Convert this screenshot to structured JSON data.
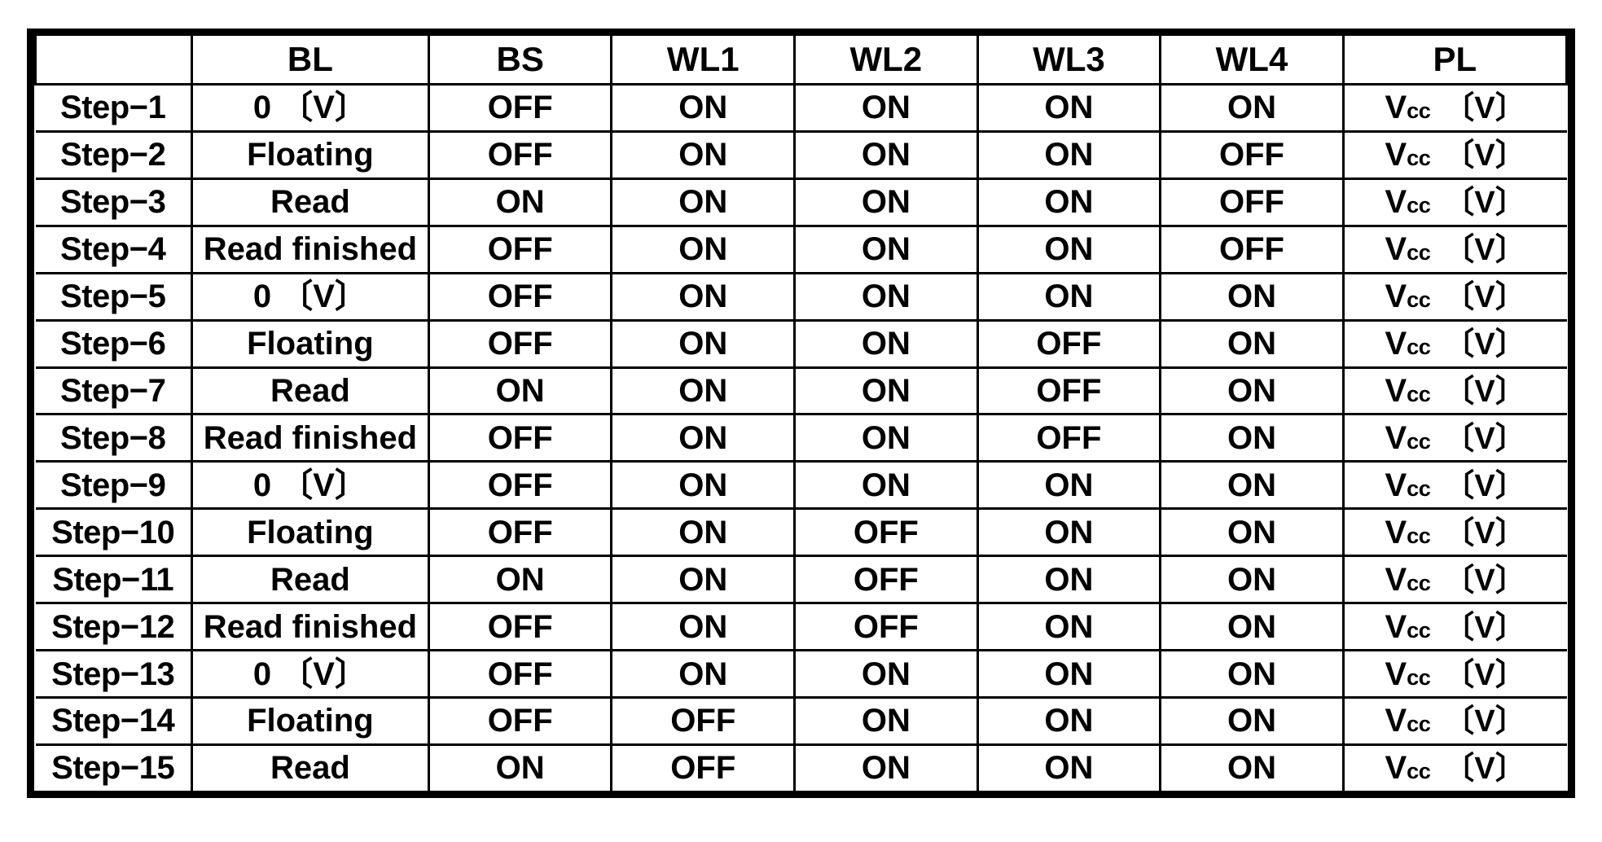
{
  "table": {
    "columns": [
      "",
      "BL",
      "BS",
      "WL1",
      "WL2",
      "WL3",
      "WL4",
      "PL"
    ],
    "header": {
      "corner": "",
      "bl": "BL",
      "bs": "BS",
      "wl1": "WL1",
      "wl2": "WL2",
      "wl3": "WL3",
      "wl4": "WL4",
      "pl": "PL"
    },
    "pl_value_prefix": "V",
    "pl_value_sub": "cc",
    "pl_value_unit": "〔V〕",
    "rows": [
      {
        "step": "Step−1",
        "bl": "0 〔V〕",
        "bs": "OFF",
        "wl1": "ON",
        "wl2": "ON",
        "wl3": "ON",
        "wl4": "ON",
        "pl": "Vcc 〔V〕"
      },
      {
        "step": "Step−2",
        "bl": "Floating",
        "bs": "OFF",
        "wl1": "ON",
        "wl2": "ON",
        "wl3": "ON",
        "wl4": "OFF",
        "pl": "Vcc 〔V〕"
      },
      {
        "step": "Step−3",
        "bl": "Read",
        "bs": "ON",
        "wl1": "ON",
        "wl2": "ON",
        "wl3": "ON",
        "wl4": "OFF",
        "pl": "Vcc 〔V〕"
      },
      {
        "step": "Step−4",
        "bl": "Read finished",
        "bs": "OFF",
        "wl1": "ON",
        "wl2": "ON",
        "wl3": "ON",
        "wl4": "OFF",
        "pl": "Vcc 〔V〕"
      },
      {
        "step": "Step−5",
        "bl": "0 〔V〕",
        "bs": "OFF",
        "wl1": "ON",
        "wl2": "ON",
        "wl3": "ON",
        "wl4": "ON",
        "pl": "Vcc 〔V〕"
      },
      {
        "step": "Step−6",
        "bl": "Floating",
        "bs": "OFF",
        "wl1": "ON",
        "wl2": "ON",
        "wl3": "OFF",
        "wl4": "ON",
        "pl": "Vcc 〔V〕"
      },
      {
        "step": "Step−7",
        "bl": "Read",
        "bs": "ON",
        "wl1": "ON",
        "wl2": "ON",
        "wl3": "OFF",
        "wl4": "ON",
        "pl": "Vcc 〔V〕"
      },
      {
        "step": "Step−8",
        "bl": "Read finished",
        "bs": "OFF",
        "wl1": "ON",
        "wl2": "ON",
        "wl3": "OFF",
        "wl4": "ON",
        "pl": "Vcc 〔V〕"
      },
      {
        "step": "Step−9",
        "bl": "0 〔V〕",
        "bs": "OFF",
        "wl1": "ON",
        "wl2": "ON",
        "wl3": "ON",
        "wl4": "ON",
        "pl": "Vcc 〔V〕"
      },
      {
        "step": "Step−10",
        "bl": "Floating",
        "bs": "OFF",
        "wl1": "ON",
        "wl2": "OFF",
        "wl3": "ON",
        "wl4": "ON",
        "pl": "Vcc 〔V〕"
      },
      {
        "step": "Step−11",
        "bl": "Read",
        "bs": "ON",
        "wl1": "ON",
        "wl2": "OFF",
        "wl3": "ON",
        "wl4": "ON",
        "pl": "Vcc 〔V〕"
      },
      {
        "step": "Step−12",
        "bl": "Read finished",
        "bs": "OFF",
        "wl1": "ON",
        "wl2": "OFF",
        "wl3": "ON",
        "wl4": "ON",
        "pl": "Vcc 〔V〕"
      },
      {
        "step": "Step−13",
        "bl": "0 〔V〕",
        "bs": "OFF",
        "wl1": "ON",
        "wl2": "ON",
        "wl3": "ON",
        "wl4": "ON",
        "pl": "Vcc 〔V〕"
      },
      {
        "step": "Step−14",
        "bl": "Floating",
        "bs": "OFF",
        "wl1": "OFF",
        "wl2": "ON",
        "wl3": "ON",
        "wl4": "ON",
        "pl": "Vcc 〔V〕"
      },
      {
        "step": "Step−15",
        "bl": "Read",
        "bs": "ON",
        "wl1": "OFF",
        "wl2": "ON",
        "wl3": "ON",
        "wl4": "ON",
        "pl": "Vcc 〔V〕"
      }
    ]
  },
  "colors": {
    "ink": "#000000",
    "paper": "#ffffff"
  }
}
